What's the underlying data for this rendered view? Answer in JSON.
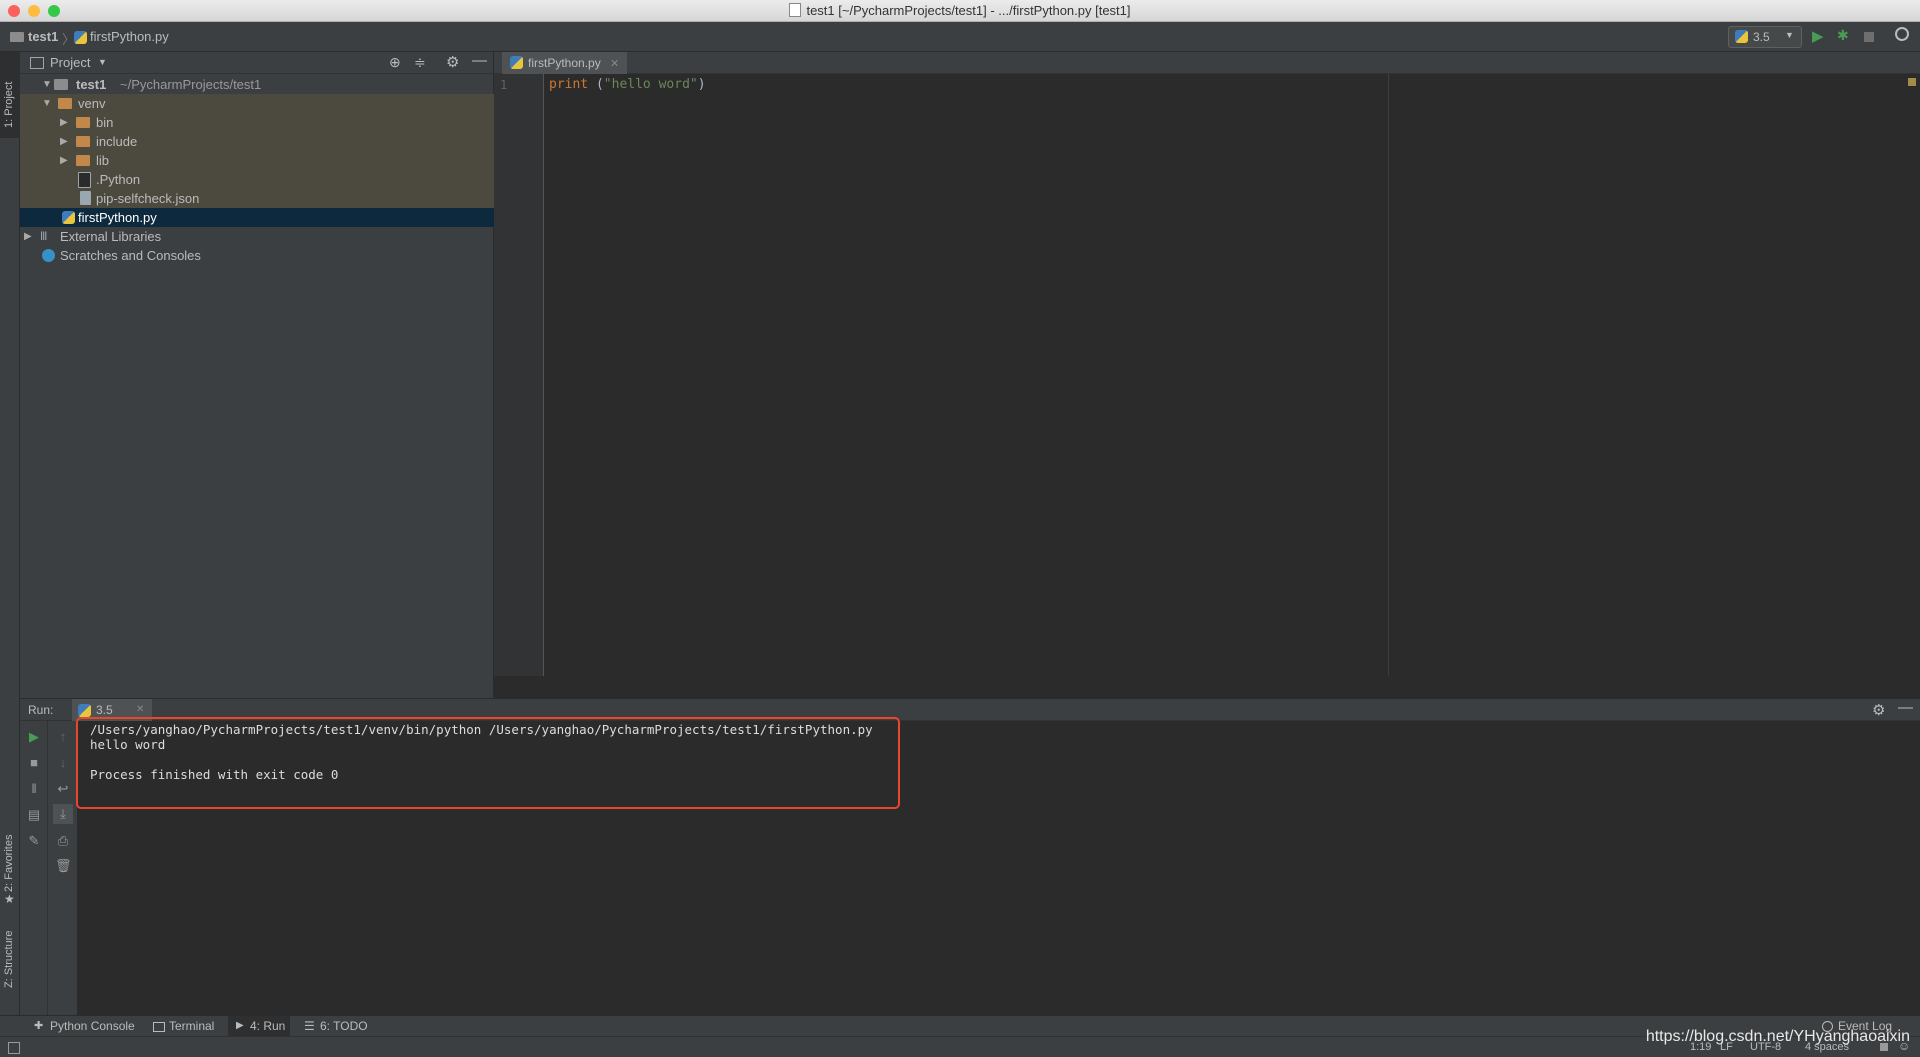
{
  "window": {
    "title": "test1 [~/PycharmProjects/test1] - .../firstPython.py [test1]"
  },
  "navbar": {
    "project": "test1",
    "file": "firstPython.py",
    "interpreter": "3.5"
  },
  "side_tabs": {
    "project": "1: Project",
    "favorites": "2: Favorites",
    "structure": "Z: Structure"
  },
  "project_panel": {
    "title": "Project",
    "tree": [
      {
        "label": "test1",
        "suffix": "~/PycharmProjects/test1",
        "kind": "folder-root"
      },
      {
        "label": "venv",
        "kind": "folder"
      },
      {
        "label": "bin",
        "kind": "folder"
      },
      {
        "label": "include",
        "kind": "folder"
      },
      {
        "label": "lib",
        "kind": "folder"
      },
      {
        "label": ".Python",
        "kind": "file"
      },
      {
        "label": "pip-selfcheck.json",
        "kind": "file"
      },
      {
        "label": "firstPython.py",
        "kind": "python"
      },
      {
        "label": "External Libraries",
        "kind": "libraries"
      },
      {
        "label": "Scratches and Consoles",
        "kind": "scratches"
      }
    ]
  },
  "editor": {
    "tab": "firstPython.py",
    "line_number": "1",
    "code": {
      "keyword": "print",
      "open": " (",
      "string": "\"hello word\"",
      "close": ")"
    }
  },
  "run_panel": {
    "label": "Run:",
    "config": "3.5",
    "output": {
      "command": "/Users/yanghao/PycharmProjects/test1/venv/bin/python /Users/yanghao/PycharmProjects/test1/firstPython.py",
      "stdout": "hello word",
      "exit": "Process finished with exit code 0"
    }
  },
  "bottom_tabs": [
    "Python Console",
    "Terminal",
    "4: Run",
    "6: TODO"
  ],
  "event_log": "Event Log",
  "status": {
    "position": "1:19",
    "line_sep": "LF",
    "encoding": "UTF-8",
    "indent": "4 spaces"
  },
  "watermark": "https://blog.csdn.net/YHyanghaoaixin",
  "colors": {
    "accent_run": "#499c54",
    "highlight_box": "#e8472a",
    "keyword": "#cc7832",
    "string": "#6a8759"
  }
}
